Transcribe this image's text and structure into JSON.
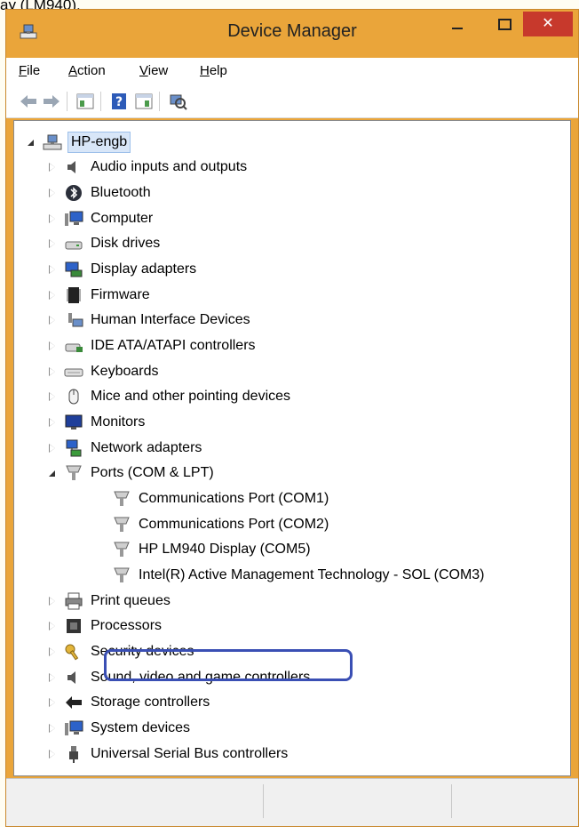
{
  "caption": "ay (LM940).",
  "window": {
    "title": "Device Manager",
    "close_glyph": "✕"
  },
  "menu": [
    {
      "label": "File",
      "accel": "F",
      "rest": "ile"
    },
    {
      "label": "Action",
      "accel": "A",
      "rest": "ction"
    },
    {
      "label": "View",
      "accel": "V",
      "rest": "iew"
    },
    {
      "label": "Help",
      "accel": "H",
      "rest": "elp"
    }
  ],
  "toolbar": {
    "icons": [
      "back-arrow-icon",
      "forward-arrow-icon",
      "properties-icon",
      "help-icon",
      "action-pane-icon",
      "scan-hardware-icon"
    ]
  },
  "tree": {
    "root": {
      "label": "HP-engb",
      "icon": "computer-network-icon"
    },
    "categories": [
      {
        "label": "Audio inputs and outputs",
        "icon": "speaker-icon",
        "state": "collapsed"
      },
      {
        "label": "Bluetooth",
        "icon": "bluetooth-icon",
        "state": "collapsed"
      },
      {
        "label": "Computer",
        "icon": "computer-icon",
        "state": "collapsed"
      },
      {
        "label": "Disk drives",
        "icon": "disk-drive-icon",
        "state": "collapsed"
      },
      {
        "label": "Display adapters",
        "icon": "display-adapter-icon",
        "state": "collapsed"
      },
      {
        "label": "Firmware",
        "icon": "firmware-chip-icon",
        "state": "collapsed"
      },
      {
        "label": "Human Interface Devices",
        "icon": "hid-icon",
        "state": "collapsed"
      },
      {
        "label": "IDE ATA/ATAPI controllers",
        "icon": "ide-controller-icon",
        "state": "collapsed"
      },
      {
        "label": "Keyboards",
        "icon": "keyboard-icon",
        "state": "collapsed"
      },
      {
        "label": "Mice and other pointing devices",
        "icon": "mouse-icon",
        "state": "collapsed"
      },
      {
        "label": "Monitors",
        "icon": "monitor-icon",
        "state": "collapsed"
      },
      {
        "label": "Network adapters",
        "icon": "network-adapter-icon",
        "state": "collapsed"
      },
      {
        "label": "Ports (COM & LPT)",
        "icon": "port-connector-icon",
        "state": "expanded"
      },
      {
        "label": "Communications Port (COM1)",
        "icon": "port-connector-icon",
        "state": "child"
      },
      {
        "label": "Communications Port (COM2)",
        "icon": "port-connector-icon",
        "state": "child"
      },
      {
        "label": "HP LM940 Display (COM5)",
        "icon": "port-connector-icon",
        "state": "child-highlighted"
      },
      {
        "label": "Intel(R) Active Management Technology - SOL (COM3)",
        "icon": "port-connector-icon",
        "state": "child"
      },
      {
        "label": "Print queues",
        "icon": "printer-icon",
        "state": "collapsed"
      },
      {
        "label": "Processors",
        "icon": "processor-icon",
        "state": "collapsed"
      },
      {
        "label": "Security devices",
        "icon": "security-key-icon",
        "state": "collapsed"
      },
      {
        "label": "Sound, video and game controllers",
        "icon": "speaker-icon",
        "state": "collapsed"
      },
      {
        "label": "Storage controllers",
        "icon": "storage-controller-icon",
        "state": "collapsed"
      },
      {
        "label": "System devices",
        "icon": "computer-icon",
        "state": "collapsed"
      },
      {
        "label": "Universal Serial Bus controllers",
        "icon": "usb-plug-icon",
        "state": "collapsed"
      }
    ]
  },
  "colors": {
    "titlebar": "#eaa53a",
    "close": "#c7392c",
    "highlight_ring": "#3a4fb4",
    "selection": "#d8e6f8"
  }
}
